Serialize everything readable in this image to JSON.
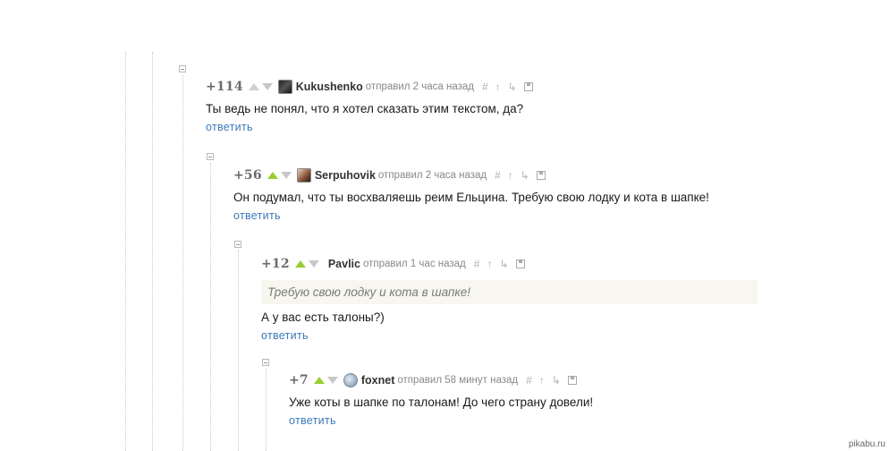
{
  "comments": [
    {
      "rating": "+114",
      "author": "Kukushenko",
      "posted": "отправил 2 часа назад",
      "text": "Ты ведь не понял, что я хотел сказать этим текстом, да?",
      "reply": "ответить",
      "avatar_icon": "avatar-dark-icon"
    },
    {
      "rating": "+56",
      "author": "Serpuhovik",
      "posted": "отправил 2 часа назад",
      "text": "Он подумал, что ты восхваляешь реим Ельцина. Требую свою лодку и кота в шапке!",
      "reply": "ответить",
      "avatar_icon": "avatar-face-icon"
    },
    {
      "rating": "+12",
      "author": "Pavlic",
      "posted": "отправил 1 час назад",
      "quote": "Требую свою лодку и кота в шапке!",
      "text": "А у вас есть талоны?)",
      "reply": "ответить"
    },
    {
      "rating": "+7",
      "author": "foxnet",
      "posted": "отправил 58 минут назад",
      "text": "Уже коты в шапке по талонам! До чего страну довели!",
      "reply": "ответить",
      "avatar_icon": "avatar-globe-icon"
    }
  ],
  "tools": {
    "link": "#",
    "parent": "↑",
    "thread": "↳"
  },
  "colors": {
    "upvote": "#9acd32",
    "reply_link": "#3a7ab8",
    "quote_bg": "#f7f6ef"
  },
  "watermark": "pikabu.ru"
}
